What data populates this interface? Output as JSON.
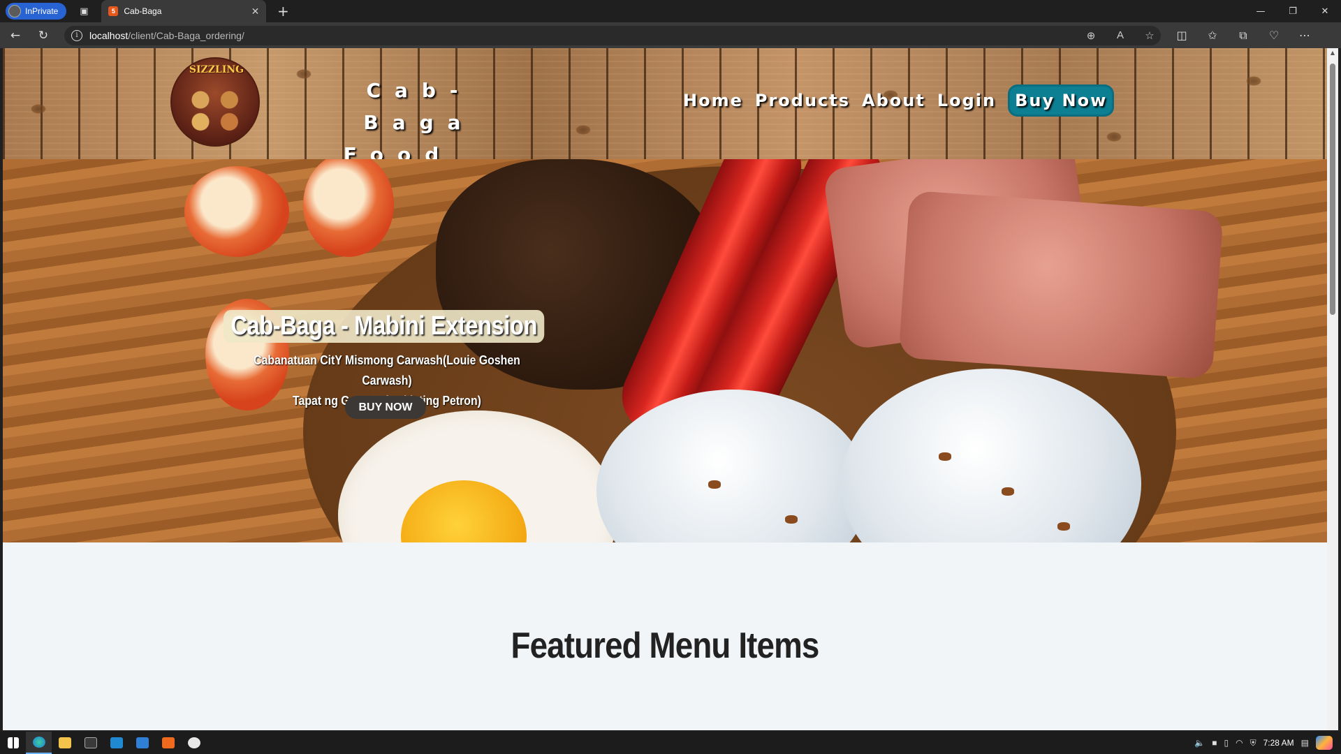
{
  "browser": {
    "inprivate_label": "InPrivate",
    "tab_title": "Cab-Baga",
    "url_host": "localhost",
    "url_path": "/client/Cab-Baga_ordering/"
  },
  "header": {
    "brand_line1": "Cab-Baga",
    "brand_line2": "Food Ordering",
    "logo_text": "SIZZLING",
    "nav": {
      "home": "Home",
      "products": "Products",
      "about": "About",
      "login": "Login",
      "buy_now": "Buy Now"
    }
  },
  "hero": {
    "title": "Cab-Baga - Mabini Extension",
    "subtitle_line1": "Cabanatuan CitY Mismong Carwash(Louie Goshen Carwash)",
    "subtitle_line2": "Tapat ng Gas Station(dating Petron)",
    "button": "BUY NOW"
  },
  "featured": {
    "title": "Featured Menu Items"
  },
  "taskbar": {
    "clock": "7:28 AM"
  },
  "colors": {
    "buy_now_bg": "#0c7f93",
    "hero_button_bg": "#3b3835",
    "page_bg": "#f1f5f8",
    "inprivate_bg": "#2863d4"
  }
}
